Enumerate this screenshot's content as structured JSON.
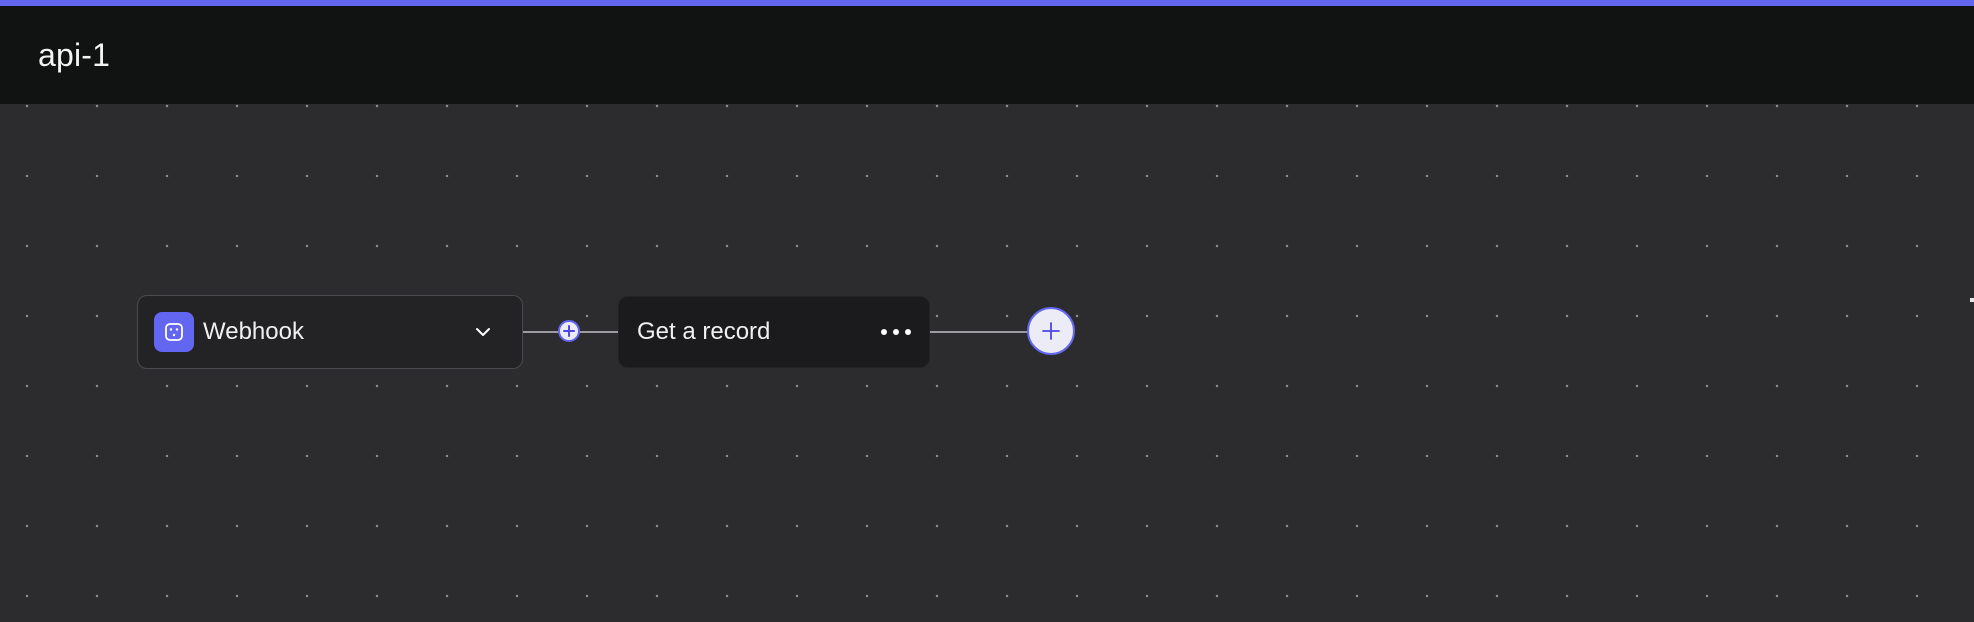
{
  "workflow": {
    "title": "api-1"
  },
  "colors": {
    "accent": "#6366f1",
    "header_background": "#111313",
    "canvas_background": "#2c2c2f",
    "node_background": "#232326"
  },
  "nodes": {
    "trigger": {
      "label": "Webhook",
      "icon": "webhook-icon",
      "menu_icon": "chevron-down-icon"
    },
    "action": {
      "label": "Get a record",
      "menu_icon": "more-horizontal-icon"
    }
  },
  "controls": {
    "insert_step_icon": "plus-circle-icon",
    "add_step_icon": "plus-icon"
  }
}
